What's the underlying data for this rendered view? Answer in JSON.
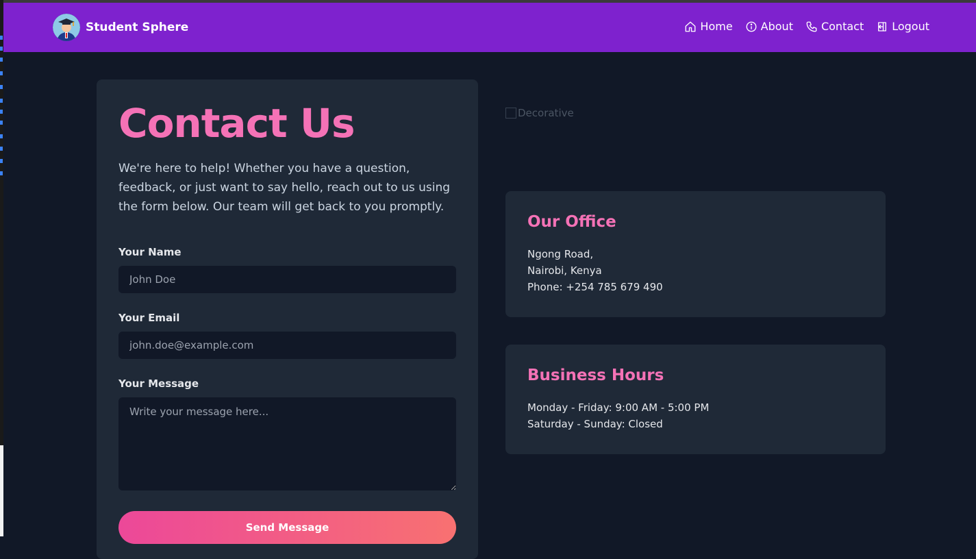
{
  "nav": {
    "brand": "Student Sphere",
    "links": [
      {
        "label": "Home",
        "icon": "home-icon"
      },
      {
        "label": "About",
        "icon": "info-icon"
      },
      {
        "label": "Contact",
        "icon": "phone-icon"
      },
      {
        "label": "Logout",
        "icon": "logout-icon"
      }
    ]
  },
  "contact": {
    "title": "Contact Us",
    "intro": "We're here to help! Whether you have a question, feedback, or just want to say hello, reach out to us using the form below. Our team will get back to you promptly.",
    "name_label": "Your Name",
    "name_placeholder": "John Doe",
    "email_label": "Your Email",
    "email_placeholder": "john.doe@example.com",
    "message_label": "Your Message",
    "message_placeholder": "Write your message here...",
    "send_label": "Send Message"
  },
  "decorative_alt": "Decorative",
  "office": {
    "title": "Our Office",
    "lines": [
      "Ngong Road,",
      "Nairobi, Kenya",
      "Phone: +254 785 679 490"
    ]
  },
  "hours": {
    "title": "Business Hours",
    "lines": [
      "Monday - Friday: 9:00 AM - 5:00 PM",
      "Saturday - Sunday: Closed"
    ]
  },
  "colors": {
    "navbar": "#7e22ce",
    "background": "#111827",
    "card": "#1f2937",
    "accent": "#f472b6",
    "button_gradient_start": "#ec4899",
    "button_gradient_end": "#f87171"
  }
}
